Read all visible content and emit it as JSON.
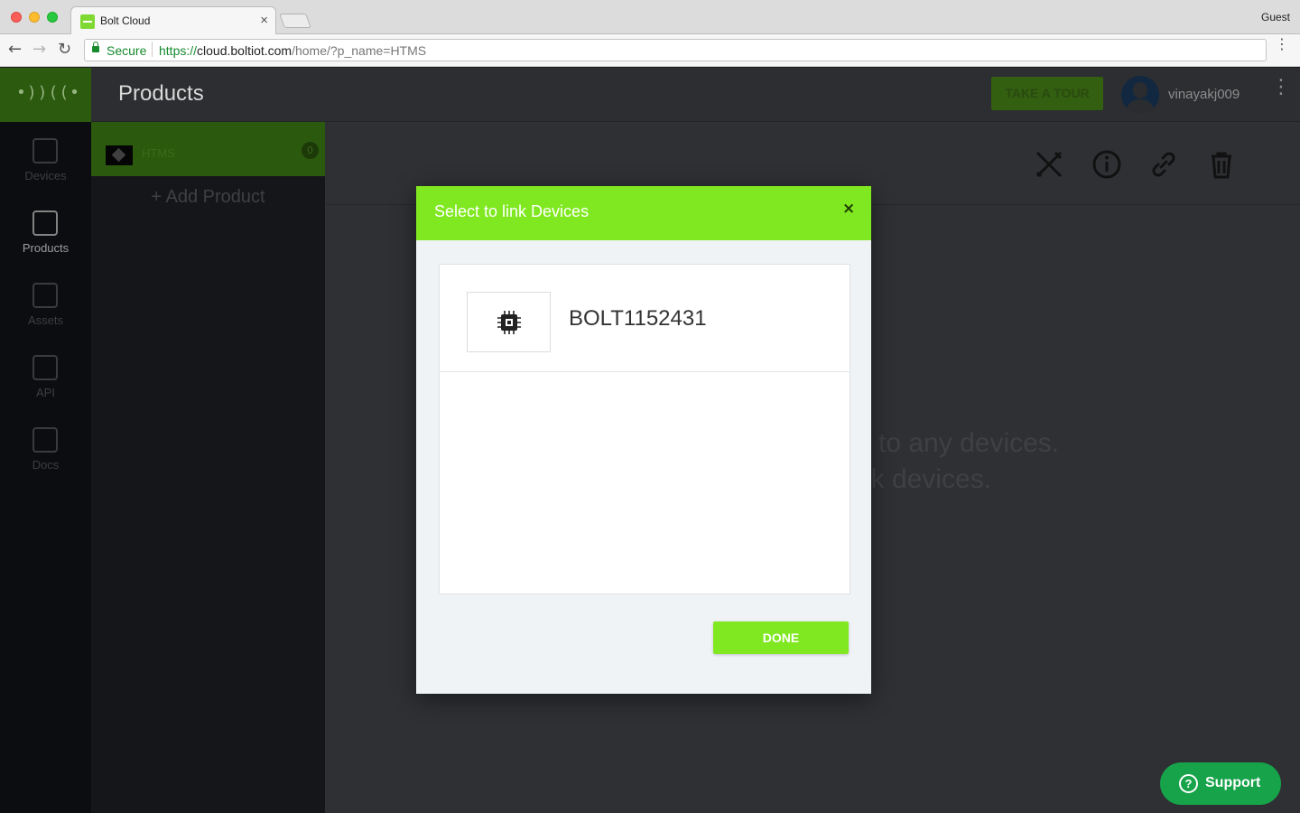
{
  "browser": {
    "tab_title": "Bolt Cloud",
    "tab_close": "×",
    "profile": "Guest",
    "secure_label": "Secure",
    "url_scheme": "https://",
    "url_host": "cloud.boltiot.com",
    "url_path": "/home/?p_name=HTMS",
    "menu": "⋮"
  },
  "app": {
    "logo_text": "•))((•",
    "page_title": "Products",
    "tour_button": "TAKE A TOUR",
    "username": "vinayakj009",
    "menu": "⋮",
    "sidebar": [
      {
        "label": "Devices"
      },
      {
        "label": "Products"
      },
      {
        "label": "Assets"
      },
      {
        "label": "API"
      },
      {
        "label": "Docs"
      }
    ],
    "product": {
      "name": "HTMS",
      "count": "0"
    },
    "add_product": "+ Add Product",
    "empty_line1": "d to any devices.",
    "empty_line2": "nk devices."
  },
  "modal": {
    "title": "Select to link Devices",
    "close": "×",
    "devices": [
      {
        "name": "BOLT1152431"
      }
    ],
    "done_button": "DONE"
  },
  "support": {
    "icon_text": "?",
    "label": "Support"
  },
  "colors": {
    "accent_green": "#80e820",
    "support_green": "#16a34a",
    "secure_green": "#178a2e"
  }
}
